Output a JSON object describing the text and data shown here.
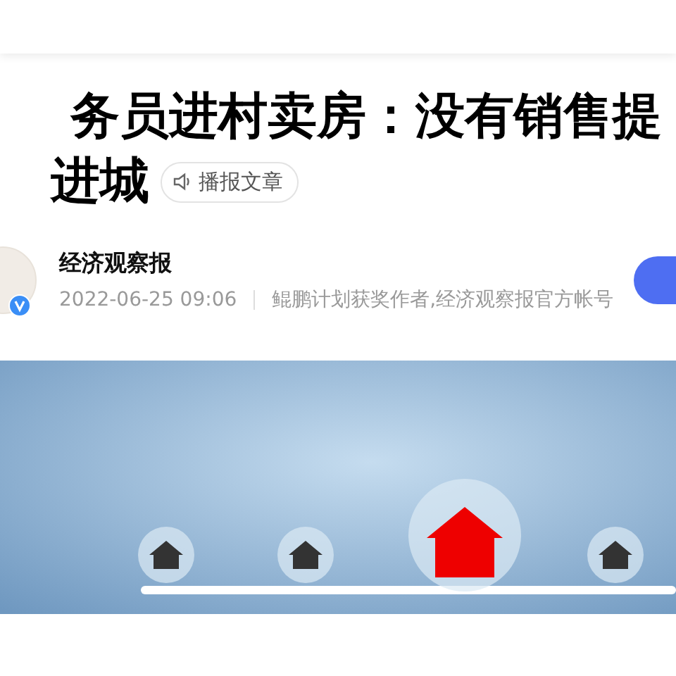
{
  "article": {
    "title_lines": [
      "务员进村卖房：没有销售提",
      "进城"
    ],
    "listen_button": {
      "label": "播报文章"
    },
    "author": {
      "name": "经济观察报",
      "verified": true,
      "date": "2022-06-25 09:06",
      "description": "鲲鹏计划获奖作者,经济观察报官方帐号"
    }
  }
}
